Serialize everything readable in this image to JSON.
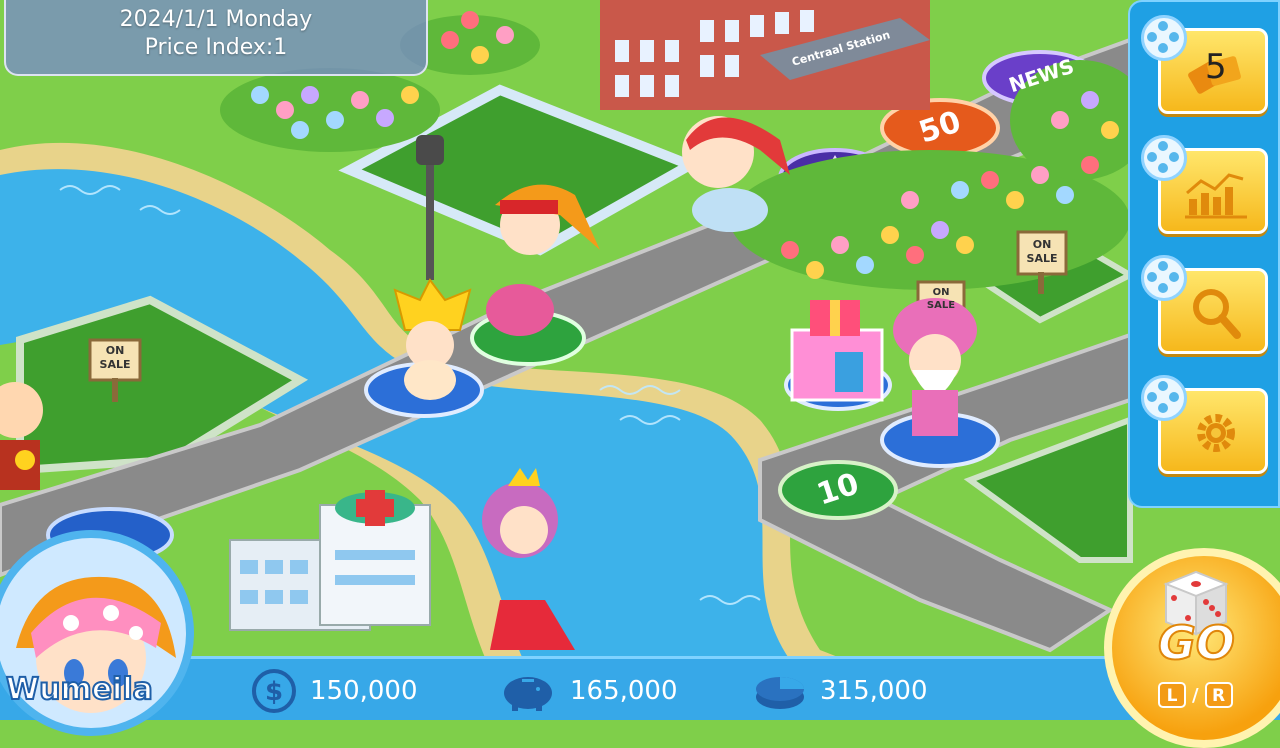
{
  "status": {
    "date": "2024/1/1 Monday",
    "price_index": "Price Index:1"
  },
  "board": {
    "tiles": [
      {
        "name": "news-tile",
        "label": "NEWS"
      },
      {
        "name": "fifty-tile",
        "label": "50"
      },
      {
        "name": "ten-tile",
        "label": "10"
      }
    ],
    "signs": [
      "ON SALE",
      "ON SALE",
      "ON SALE"
    ],
    "station_sign": "Centraal Station"
  },
  "side_menu": {
    "cards_count": "5",
    "buttons": [
      {
        "name": "cards-button",
        "icon": "cards-icon"
      },
      {
        "name": "stocks-button",
        "icon": "chart-icon"
      },
      {
        "name": "search-button",
        "icon": "magnifier-icon"
      },
      {
        "name": "settings-button",
        "icon": "gear-icon"
      }
    ]
  },
  "player": {
    "name": "Wumeila",
    "cash": "150,000",
    "savings": "165,000",
    "total_assets": "315,000"
  },
  "go_button": {
    "label": "GO",
    "left_key": "L",
    "separator": "/",
    "right_key": "R"
  },
  "colors": {
    "bar_blue": "#37a8e8",
    "menu_blue": "#1fa0e4",
    "button_yellow": "#f6b81c",
    "grass": "#7fcf4a",
    "road": "#8a8a8a",
    "river": "#3db2ea"
  }
}
